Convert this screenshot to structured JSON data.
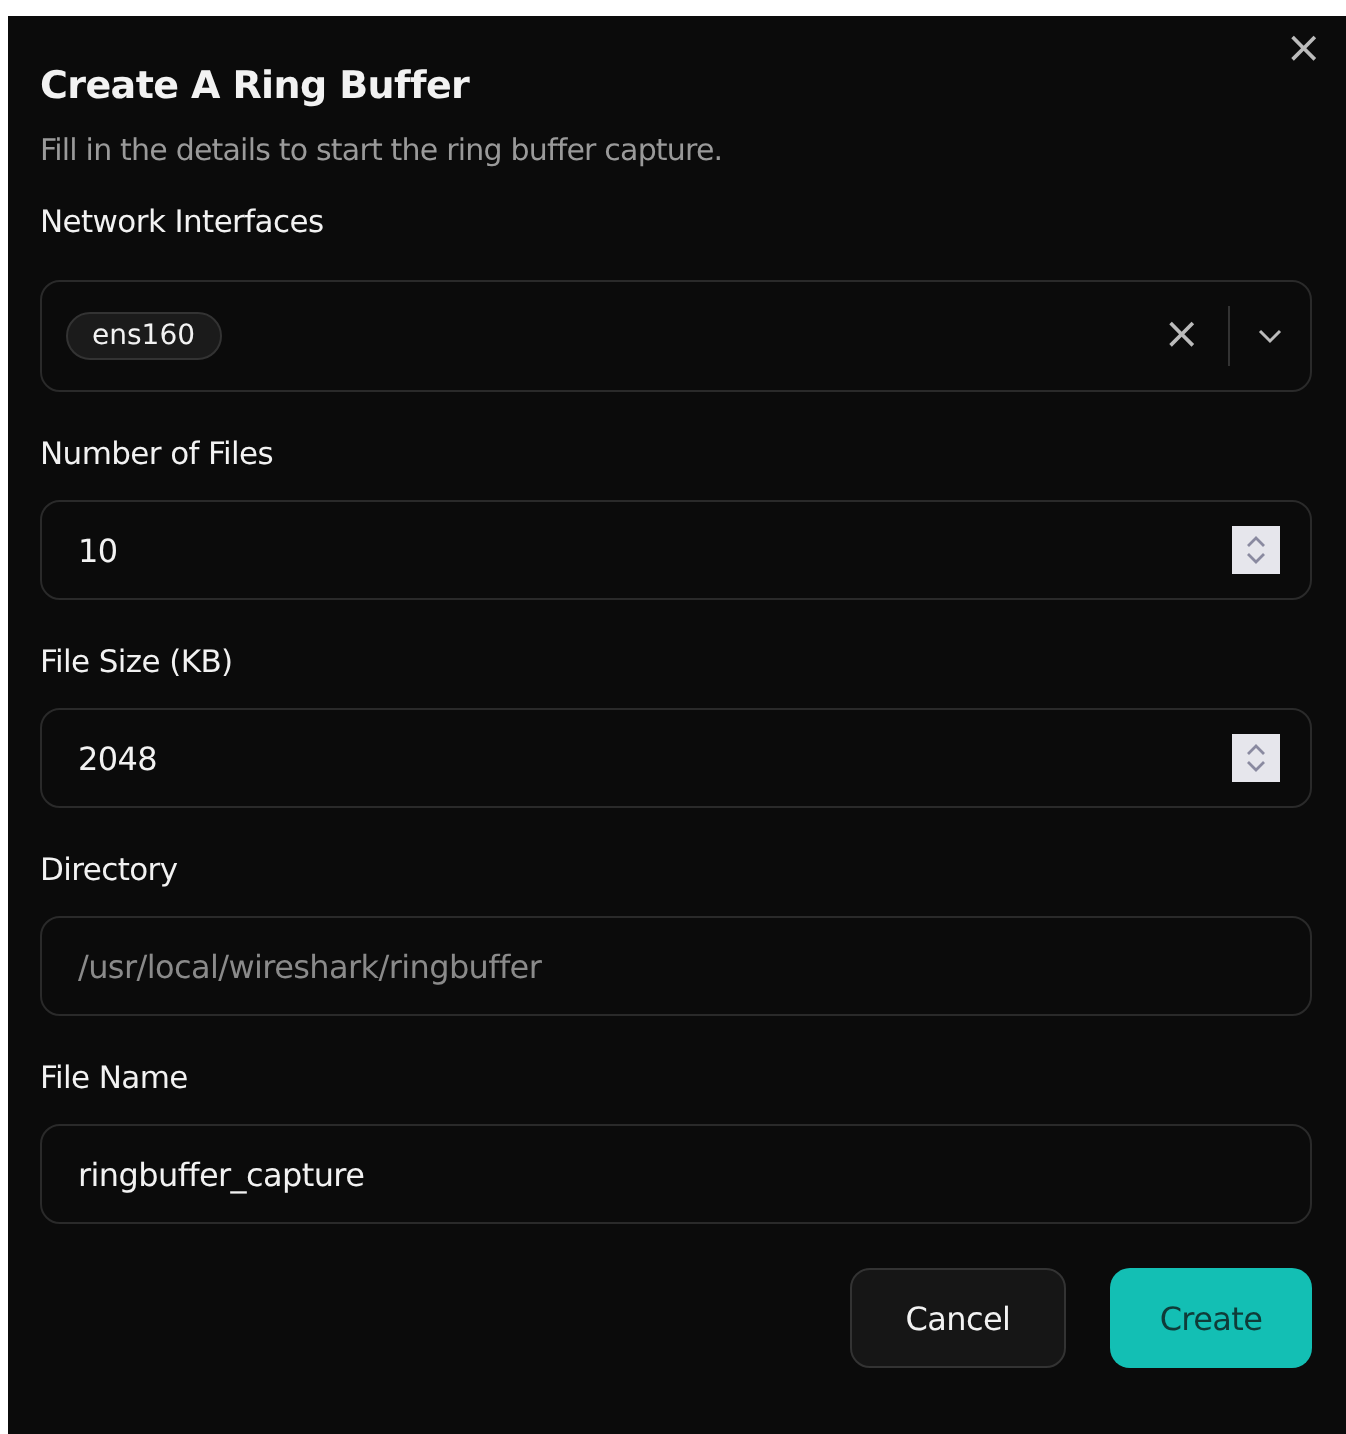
{
  "dialog": {
    "title": "Create A Ring Buffer",
    "description": "Fill in the details to start the ring buffer capture.",
    "close": "×"
  },
  "fields": [
    {
      "kind": "multiselect",
      "label": "Network Interfaces",
      "tags": [
        "ens160"
      ],
      "clear": "×"
    },
    {
      "kind": "number",
      "label": "Number of Files",
      "value": "10"
    },
    {
      "kind": "number",
      "label": "File Size (KB)",
      "value": "2048"
    },
    {
      "kind": "text",
      "label": "Directory",
      "placeholder": "/usr/local/wireshark/ringbuffer"
    },
    {
      "kind": "text",
      "label": "File Name",
      "value": "ringbuffer_capture"
    }
  ],
  "buttons": [
    {
      "label": "Cancel",
      "kind": "secondary"
    },
    {
      "label": "Create",
      "kind": "primary"
    }
  ]
}
